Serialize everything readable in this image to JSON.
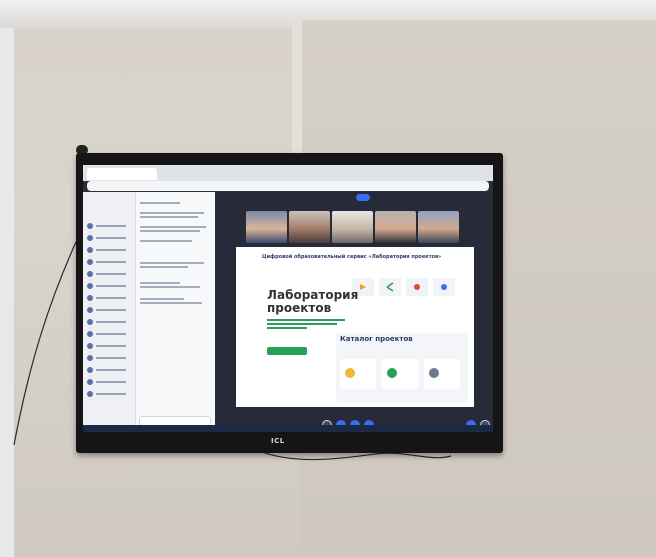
{
  "slide": {
    "heading": "Цифровой образовательный сервис «Лаборатория проектов»",
    "title_line1": "Лаборатория",
    "title_line2": "проектов",
    "catalog_title": "Каталог проектов"
  },
  "tv": {
    "brand_logo": "ICL"
  },
  "colors": {
    "wall": "#d6d1c9",
    "tv_frame": "#151515",
    "meeting_bg": "#262a39",
    "slide_bg": "#ffffff",
    "accent_green": "#27a153",
    "accent_blue": "#3a6df0",
    "heading_blue": "#2c3e63"
  }
}
